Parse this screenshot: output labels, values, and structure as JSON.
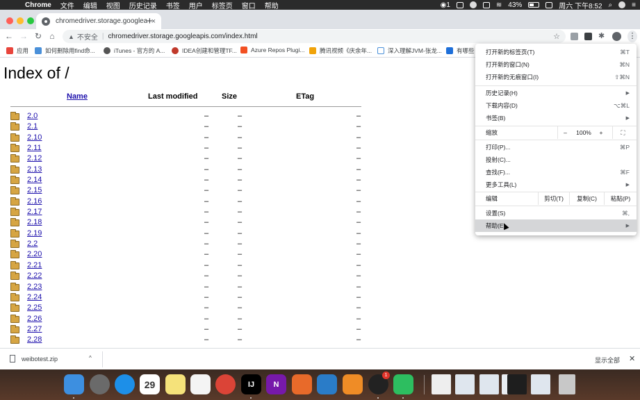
{
  "menubar": {
    "app_name": "Chrome",
    "items": [
      "文件",
      "编辑",
      "视图",
      "历史记录",
      "书签",
      "用户",
      "标签页",
      "窗口",
      "帮助"
    ],
    "notification_count": "1",
    "battery": "43%",
    "clock": "周六 下午8:52"
  },
  "tab": {
    "title": "chromedriver.storage.googleapis.com/index.html",
    "close": "×",
    "new_tab": "+"
  },
  "toolbar": {
    "back": "←",
    "forward": "→",
    "reload": "↻",
    "home": "⌂",
    "security_icon": "▲",
    "security_text": "不安全",
    "url": "chromedriver.storage.googleapis.com/index.html",
    "star": "☆",
    "kebab": "⋮"
  },
  "bookmarks": [
    {
      "label": "应用",
      "color": "#e8453c"
    },
    {
      "label": "如何删除用find命...",
      "color": "#4a90d9"
    },
    {
      "label": "iTunes - 官方的 A...",
      "color": "#555555"
    },
    {
      "label": "IDEA创建和管理TF...",
      "color": "#c0392b"
    },
    {
      "label": "Azure Repos Plugi...",
      "color": "#f25022"
    },
    {
      "label": "腾讯视频《庆余年...",
      "color": "#f0a30a"
    },
    {
      "label": "深入理解JVM-张龙...",
      "color": "#4a90d9"
    },
    {
      "label": "有哪些",
      "color": "#1e6fd9"
    }
  ],
  "page": {
    "title": "Index of /",
    "headers": {
      "name": "Name",
      "modified": "Last modified",
      "size": "Size",
      "etag": "ETag"
    },
    "dash": "–",
    "rows": [
      "2.0",
      "2.1",
      "2.10",
      "2.11",
      "2.12",
      "2.13",
      "2.14",
      "2.15",
      "2.16",
      "2.17",
      "2.18",
      "2.19",
      "2.2",
      "2.20",
      "2.21",
      "2.22",
      "2.23",
      "2.24",
      "2.25",
      "2.26",
      "2.27",
      "2.28"
    ]
  },
  "menu": {
    "new_tab": {
      "label": "打开新的标签页(T)",
      "shortcut": "⌘T"
    },
    "new_window": {
      "label": "打开新的窗口(N)",
      "shortcut": "⌘N"
    },
    "new_incognito": {
      "label": "打开新的无痕窗口(I)",
      "shortcut": "⇧⌘N"
    },
    "history": {
      "label": "历史记录(H)"
    },
    "downloads": {
      "label": "下载内容(D)",
      "shortcut": "⌥⌘L"
    },
    "bookmarks": {
      "label": "书签(B)"
    },
    "zoom": {
      "label": "缩放",
      "minus": "–",
      "value": "100%",
      "plus": "+",
      "fullscreen": "⛶"
    },
    "print": {
      "label": "打印(P)...",
      "shortcut": "⌘P"
    },
    "cast": {
      "label": "投射(C)..."
    },
    "find": {
      "label": "查找(F)...",
      "shortcut": "⌘F"
    },
    "more_tools": {
      "label": "更多工具(L)"
    },
    "edit": {
      "label": "编辑",
      "cut": "剪切(T)",
      "copy": "复制(C)",
      "paste": "粘贴(P)"
    },
    "settings": {
      "label": "设置(S)",
      "shortcut": "⌘,"
    },
    "help": {
      "label": "帮助(E)"
    },
    "submenu_arrow": "▶"
  },
  "download_bar": {
    "filename": "weibotest.zip",
    "caret": "^",
    "show_all": "显示全部",
    "close": "✕"
  },
  "dock": {
    "calendar_day": "29",
    "badge": "1",
    "icons": [
      {
        "name": "finder",
        "color": "#3d8fe0",
        "glyph": ""
      },
      {
        "name": "launchpad",
        "color": "#6a6a6a",
        "glyph": ""
      },
      {
        "name": "safari",
        "color": "#1d8fe8",
        "glyph": ""
      },
      {
        "name": "calendar",
        "color": "#ffffff",
        "glyph": ""
      },
      {
        "name": "notes",
        "color": "#f5e27a",
        "glyph": ""
      },
      {
        "name": "reminders",
        "color": "#f4f4f4",
        "glyph": ""
      },
      {
        "name": "chrome",
        "color": "#db4437",
        "glyph": ""
      },
      {
        "name": "intellij",
        "color": "#000000",
        "glyph": "IJ"
      },
      {
        "name": "onenote",
        "color": "#7719aa",
        "glyph": "N"
      },
      {
        "name": "paint",
        "color": "#e86a2a",
        "glyph": ""
      },
      {
        "name": "vscode",
        "color": "#2a7cc8",
        "glyph": ""
      },
      {
        "name": "sublime",
        "color": "#ef8c26",
        "glyph": ""
      },
      {
        "name": "qq",
        "color": "#222222",
        "glyph": ""
      },
      {
        "name": "evernote",
        "color": "#2dbe60",
        "glyph": ""
      }
    ],
    "recents": [
      {
        "name": "document",
        "color": "#eeeeee"
      },
      {
        "name": "screenshot-1",
        "color": "#dfe6ee"
      },
      {
        "name": "screenshot-2",
        "color": "#dfe6ee"
      },
      {
        "name": "screenshot-3",
        "color": "#e9edf2"
      },
      {
        "name": "terminal",
        "color": "#1e1e1e"
      },
      {
        "name": "screenshot-4",
        "color": "#dfe6ee"
      },
      {
        "name": "trash",
        "color": "#c8c8c8"
      }
    ]
  }
}
